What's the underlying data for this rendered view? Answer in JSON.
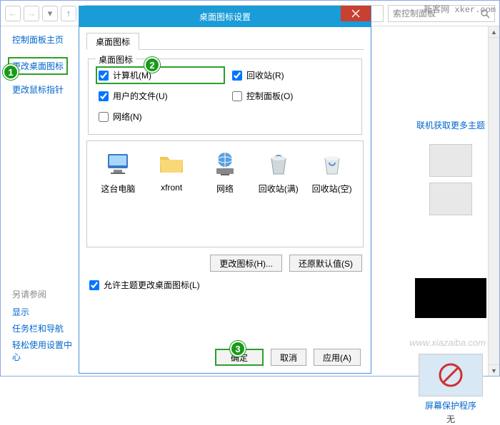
{
  "watermark": "新客网 xker.com",
  "watermark2": "www.xiazaiba.com",
  "toolbar": {
    "search_placeholder": "索控制面板"
  },
  "sidebar": {
    "title": "控制面板主页",
    "links": [
      "更改桌面图标",
      "更改鼠标指针"
    ],
    "see_also_title": "另请参阅",
    "see_also": [
      "显示",
      "任务栏和导航",
      "轻松使用设置中心"
    ]
  },
  "right": {
    "more_themes": "联机获取更多主题",
    "screensaver_label": "屏幕保护程序",
    "screensaver_value": "无"
  },
  "dialog": {
    "title": "桌面图标设置",
    "tab": "桌面图标",
    "group_legend": "桌面图标",
    "checkboxes": {
      "computer": {
        "label": "计算机(M)",
        "checked": true
      },
      "recycle": {
        "label": "回收站(R)",
        "checked": true
      },
      "userfiles": {
        "label": "用户的文件(U)",
        "checked": true
      },
      "ctrlpanel": {
        "label": "控制面板(O)",
        "checked": false
      },
      "network": {
        "label": "网络(N)",
        "checked": false
      }
    },
    "icons": [
      "这台电脑",
      "xfront",
      "网络",
      "回收站(满)",
      "回收站(空)"
    ],
    "change_icon_btn": "更改图标(H)...",
    "restore_btn": "还原默认值(S)",
    "allow_themes": {
      "label": "允许主题更改桌面图标(L)",
      "checked": true
    },
    "ok": "确定",
    "cancel": "取消",
    "apply": "应用(A)"
  },
  "badges": {
    "b1": "1",
    "b2": "2",
    "b3": "3"
  }
}
